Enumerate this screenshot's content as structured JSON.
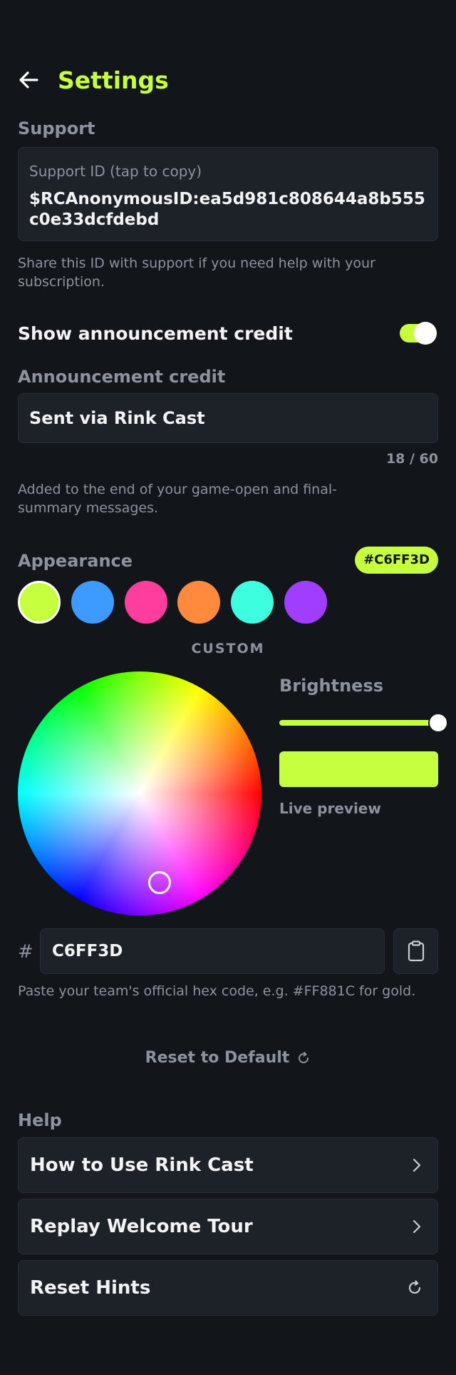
{
  "header": {
    "title": "Settings"
  },
  "support": {
    "section_title": "Support",
    "id_label": "Support ID (tap to copy)",
    "id_value": "$RCAnonymousID:ea5d981c808644a8b555c0e33dcfdebd",
    "helper": "Share this ID with support if you need help with your subscription."
  },
  "announcement": {
    "toggle_label": "Show announcement credit",
    "toggle_on": true,
    "field_label": "Announcement credit",
    "field_value": "Sent via Rink Cast",
    "counter": "18 / 60",
    "helper": "Added to the end of your game-open and final-summary messages."
  },
  "appearance": {
    "section_title": "Appearance",
    "selected_hex_badge": "#C6FF3D",
    "swatches": [
      {
        "name": "lime",
        "color": "#C6FF3D",
        "selected": true
      },
      {
        "name": "blue",
        "color": "#3D9BFF",
        "selected": false
      },
      {
        "name": "pink",
        "color": "#FF3D9E",
        "selected": false
      },
      {
        "name": "orange",
        "color": "#FF8A3D",
        "selected": false
      },
      {
        "name": "cyan",
        "color": "#3DFFE0",
        "selected": false
      },
      {
        "name": "purple",
        "color": "#A03DFF",
        "selected": false
      }
    ],
    "custom_label": "CUSTOM",
    "brightness_label": "Brightness",
    "brightness_value": 1.0,
    "live_preview_label": "Live preview",
    "live_preview_color": "#C6FF3D",
    "hex_prefix": "#",
    "hex_input_value": "C6FF3D",
    "hex_helper": "Paste your team's official hex code, e.g. #FF881C for gold.",
    "reset_label": "Reset to Default"
  },
  "help": {
    "section_title": "Help",
    "items": [
      {
        "label": "How to Use Rink Cast",
        "icon": "chevron-right-icon"
      },
      {
        "label": "Replay Welcome Tour",
        "icon": "chevron-right-icon"
      },
      {
        "label": "Reset Hints",
        "icon": "refresh-icon"
      }
    ]
  },
  "colors": {
    "accent": "#C6FF3D",
    "background": "#12151A",
    "card": "#1D2128"
  }
}
